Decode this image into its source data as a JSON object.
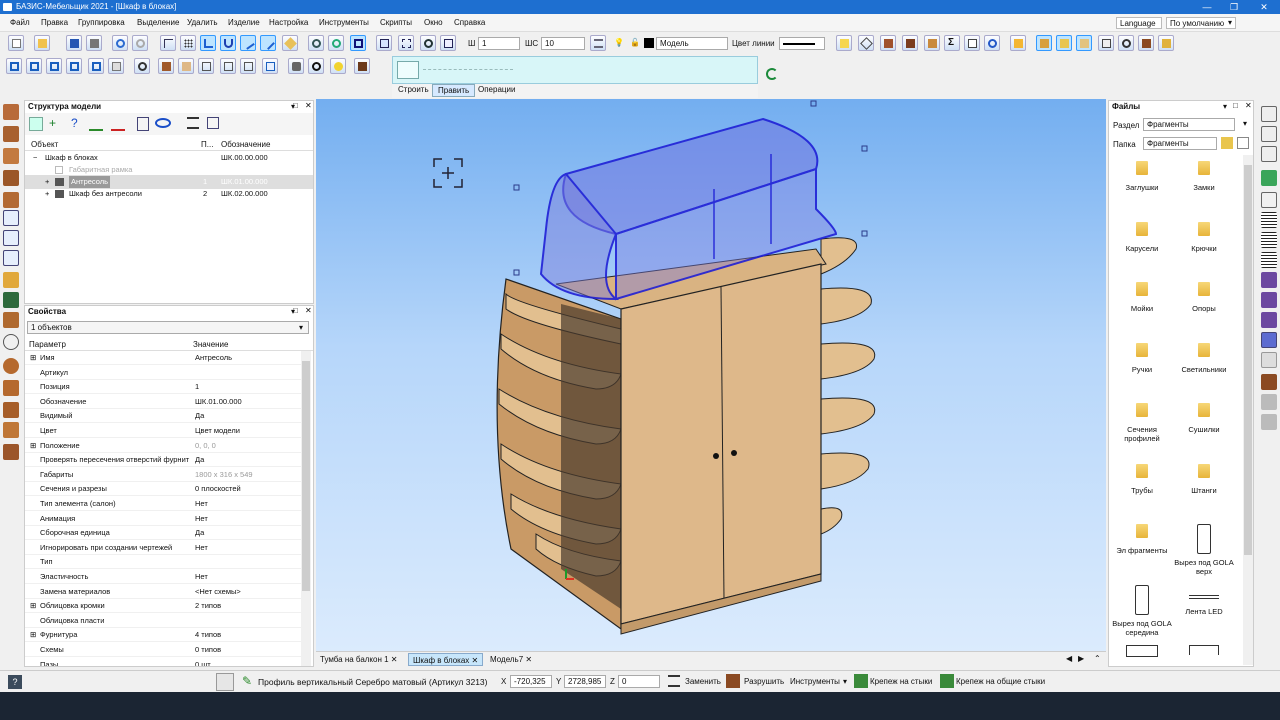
{
  "window": {
    "title": "БАЗИС-Мебельщик 2021 - [Шкаф в блоках]",
    "controls": [
      "—",
      "❐",
      "✕"
    ]
  },
  "menu": {
    "items": [
      "Файл",
      "Правка",
      "Группировка",
      "Выделение",
      "Удалить",
      "Изделие",
      "Настройка",
      "Инструменты",
      "Скрипты",
      "Окно",
      "Справка"
    ],
    "language": "Language",
    "layout": "По умолчанию"
  },
  "toolbar": {
    "w_label": "Ш",
    "w_value": "1",
    "shs_label": "ШС",
    "shs_value": "10",
    "layer_value": "Модель",
    "line_color_label": "Цвет линии"
  },
  "command_panel": {
    "tabs": [
      "Строить",
      "Править",
      "Операции"
    ],
    "active_tab": "Править"
  },
  "structure_panel": {
    "title": "Структура модели",
    "columns": [
      "Объект",
      "П...",
      "Обозначение"
    ],
    "rows": [
      {
        "name": "Шкаф в блоках",
        "pos": "",
        "code": "ШК.00.00.000"
      },
      {
        "name": "Габаритная рамка",
        "pos": "",
        "code": ""
      },
      {
        "name": "Антресоль",
        "pos": "1",
        "code": "ШК.01.00.000"
      },
      {
        "name": "Шкаф без антресоли",
        "pos": "2",
        "code": "ШК.02.00.000"
      }
    ]
  },
  "properties_panel": {
    "title": "Свойства",
    "selection": "1 объектов",
    "columns": [
      "Параметр",
      "Значение"
    ],
    "rows": [
      {
        "param": "Имя",
        "value": "Антресоль",
        "expand": true
      },
      {
        "param": "Артикул",
        "value": ""
      },
      {
        "param": "Позиция",
        "value": "1"
      },
      {
        "param": "Обозначение",
        "value": "ШК.01.00.000"
      },
      {
        "param": "Видимый",
        "value": "Да"
      },
      {
        "param": "Цвет",
        "value": "Цвет модели"
      },
      {
        "param": "Положение",
        "value": "0, 0, 0",
        "expand": true,
        "muted": true
      },
      {
        "param": "Проверять пересечения отверстий фурнит",
        "value": "Да"
      },
      {
        "param": "Габариты",
        "value": "1800 x 316 x 549",
        "muted": true
      },
      {
        "param": "Сечения и разрезы",
        "value": "0 плоскостей"
      },
      {
        "param": "Тип элемента (салон)",
        "value": "Нет"
      },
      {
        "param": "Анимация",
        "value": "Нет"
      },
      {
        "param": "Сборочная единица",
        "value": "Да"
      },
      {
        "param": "Игнорировать при создании чертежей",
        "value": "Нет"
      },
      {
        "param": "Тип",
        "value": ""
      },
      {
        "param": "Эластичность",
        "value": "Нет"
      },
      {
        "param": "Замена материалов",
        "value": "<Нет схемы>"
      },
      {
        "param": "Облицовка кромки",
        "value": "2 типов",
        "expand": true
      },
      {
        "param": "Облицовка пласти",
        "value": ""
      },
      {
        "param": "Фурнитура",
        "value": "4 типов",
        "expand": true
      },
      {
        "param": "Схемы",
        "value": "0 типов"
      },
      {
        "param": "Пазы",
        "value": "0 шт."
      }
    ]
  },
  "files_panel": {
    "title": "Файлы",
    "section_label": "Раздел",
    "section_value": "Фрагменты",
    "folder_label": "Папка",
    "folder_value": "Фрагменты",
    "items": [
      {
        "label": "Заглушки",
        "kind": "folder"
      },
      {
        "label": "Замки",
        "kind": "folder"
      },
      {
        "label": "Карусели",
        "kind": "folder"
      },
      {
        "label": "Крючки",
        "kind": "folder"
      },
      {
        "label": "Мойки",
        "kind": "folder"
      },
      {
        "label": "Опоры",
        "kind": "folder"
      },
      {
        "label": "Ручки",
        "kind": "folder"
      },
      {
        "label": "Светильники",
        "kind": "folder"
      },
      {
        "label": "Сечения профилей",
        "kind": "folder"
      },
      {
        "label": "Сушилки",
        "kind": "folder"
      },
      {
        "label": "Трубы",
        "kind": "folder"
      },
      {
        "label": "Штанги",
        "kind": "folder"
      },
      {
        "label": "Эл фрагменты",
        "kind": "folder"
      },
      {
        "label": "Вырез под GOLA верх",
        "kind": "shape-tall"
      },
      {
        "label": "Вырез под GOLA середина",
        "kind": "shape-tall"
      },
      {
        "label": "Лента LED",
        "kind": "shape-line"
      },
      {
        "label": "",
        "kind": "shape-rect"
      },
      {
        "label": "",
        "kind": "shape-profile"
      }
    ]
  },
  "doc_tabs": [
    "Тумба на балкон 1",
    "Шкаф в блоках",
    "Модель7"
  ],
  "active_doc_tab": "Шкаф в блоках",
  "status": {
    "help_icon": "?",
    "hint": "Профиль вертикальный Серебро матовый (Артикул 3213)",
    "x_label": "X",
    "x_value": "-720,325",
    "y_label": "Y",
    "y_value": "2728,985",
    "z_label": "Z",
    "z_value": "0",
    "replace": "Заменить",
    "destroy": "Разрушить",
    "tools": "Инструменты",
    "fastener": "Крепеж на стыки",
    "fastener_common": "Крепеж на общие стыки"
  },
  "colors": {
    "title_bar": "#1e6fd0",
    "wood": "#deb88a",
    "selection_blue": "#2323d8"
  }
}
